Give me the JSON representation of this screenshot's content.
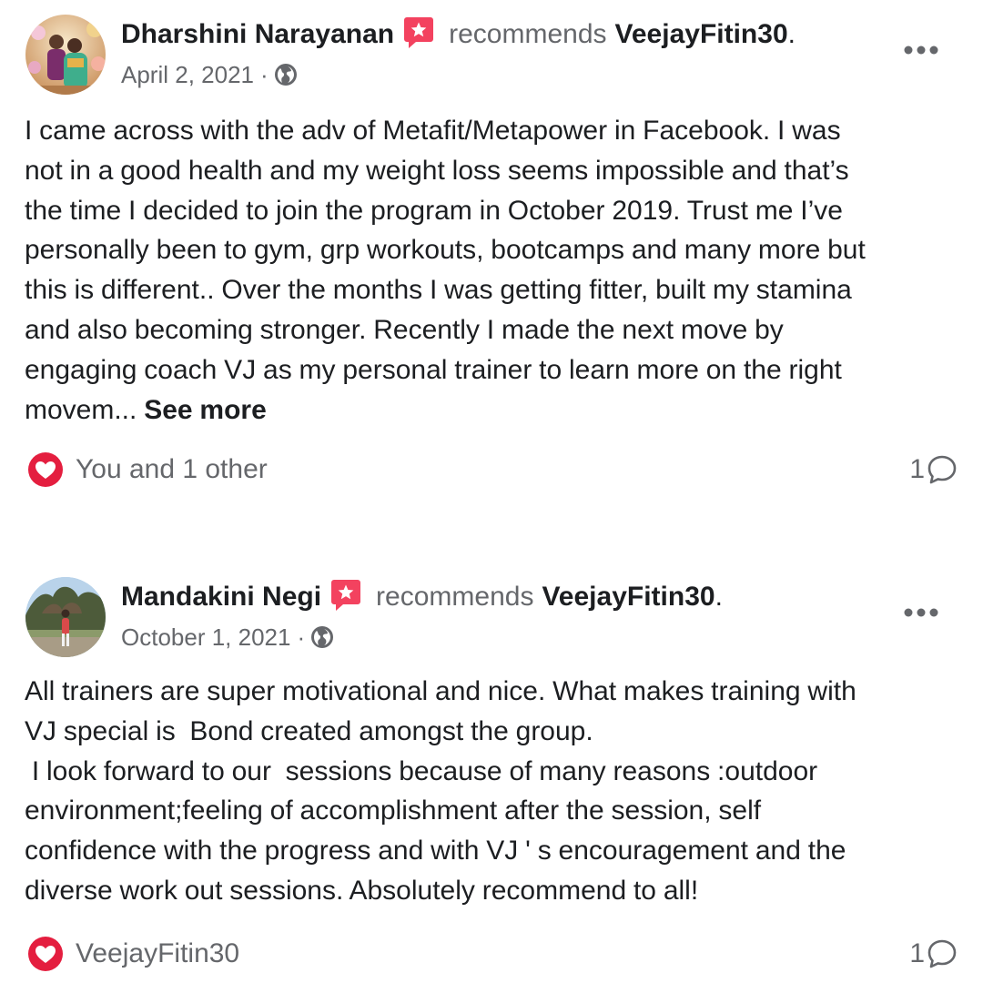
{
  "posts": [
    {
      "author": "Dharshini Narayanan",
      "action": "recommends",
      "page": "VeejayFitin30",
      "period": ".",
      "date": "April 2, 2021",
      "separator": "·",
      "body": "I came across with the adv of Metafit/Metapower in Facebook. I was\nnot in a good health and my weight loss seems impossible and that’s\nthe time I decided to join the program in October 2019. Trust me I’ve\npersonally been to gym, grp workouts, bootcamps and many more but\nthis is different.. Over the months I was getting fitter, built my stamina\nand also becoming stronger. Recently I made the next move by\nengaging coach VJ as my personal trainer to learn more on the right\nmovem... ",
      "see_more": "See more",
      "reactions": "You and 1 other",
      "comment_count": "1"
    },
    {
      "author": "Mandakini Negi",
      "action": "recommends",
      "page": "VeejayFitin30",
      "period": ".",
      "date": "October 1, 2021",
      "separator": "·",
      "body": "All trainers are super motivational and nice. What makes training with\nVJ special is  Bond created amongst the group.\n I look forward to our  sessions because of many reasons :outdoor\nenvironment;feeling of accomplishment after the session, self\nconfidence with the progress and with VJ ' s encouragement and the\ndiverse work out sessions. Absolutely recommend to all!",
      "reactions": "VeejayFitin30",
      "comment_count": "1"
    }
  ],
  "colors": {
    "text_primary": "#1c1e21",
    "text_secondary": "#65676b",
    "recommend_badge": "#f3425f",
    "heart": "#e41e3f"
  },
  "icons": {
    "recommend": "recommend-badge-icon",
    "audience": "globe-icon",
    "menu": "more-dots-icon",
    "reaction": "heart-icon",
    "comment": "comment-bubble-icon"
  }
}
